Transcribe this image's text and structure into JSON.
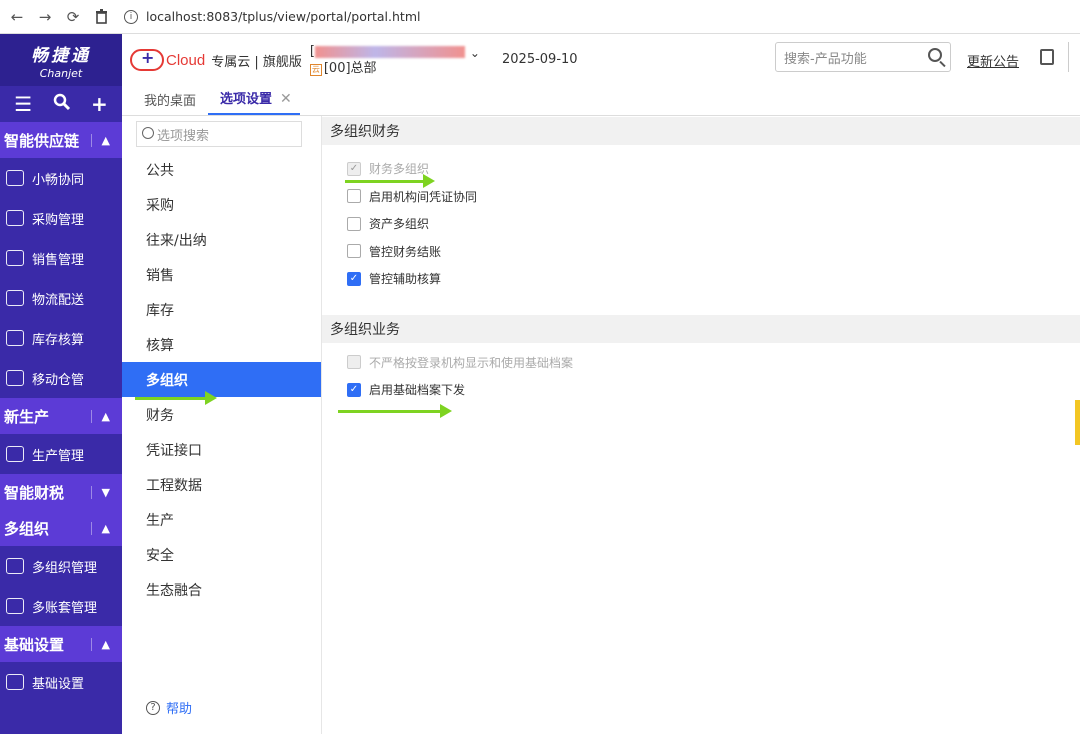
{
  "browser": {
    "back": "←",
    "forward": "→",
    "reload": "⟳",
    "info": "i",
    "url": "localhost:8083/tplus/view/portal/portal.html"
  },
  "leftnav": {
    "logo_cn": "畅捷通",
    "logo_en": "Chanjet",
    "sections": [
      {
        "label": "智能供应链",
        "items": [
          "小畅协同",
          "采购管理",
          "销售管理",
          "物流配送",
          "库存核算",
          "移动仓管"
        ]
      },
      {
        "label": "新生产",
        "items": [
          "生产管理"
        ]
      },
      {
        "label": "智能财税",
        "items": []
      },
      {
        "label": "多组织",
        "items": [
          "多组织管理",
          "多账套管理"
        ]
      },
      {
        "label": "基础设置",
        "items": [
          "基础设置"
        ]
      }
    ]
  },
  "header": {
    "brand": "Cloud",
    "edition": "专属云 | 旗舰版",
    "bracket": "[",
    "org_tag": "云",
    "org": "[00]总部",
    "date": "2025-09-10",
    "search_placeholder": "搜索-产品功能",
    "notice": "更新公告"
  },
  "tabs": [
    {
      "label": "我的桌面",
      "active": false
    },
    {
      "label": "选项设置",
      "active": true,
      "close": "✕"
    }
  ],
  "options": {
    "search_placeholder": "选项搜索",
    "items": [
      "公共",
      "采购",
      "往来/出纳",
      "销售",
      "库存",
      "核算",
      "多组织",
      "财务",
      "凭证接口",
      "工程数据",
      "生产",
      "安全",
      "生态融合"
    ],
    "active_index": 6,
    "help": "帮助",
    "help_icon": "?"
  },
  "content": {
    "groups": [
      {
        "title": "多组织财务",
        "items": [
          {
            "label": "财务多组织",
            "checked": true,
            "disabled": true
          },
          {
            "label": "启用机构间凭证协同",
            "checked": false,
            "disabled": false
          },
          {
            "label": "资产多组织",
            "checked": false,
            "disabled": false
          },
          {
            "label": "管控财务结账",
            "checked": false,
            "disabled": false
          },
          {
            "label": "管控辅助核算",
            "checked": true,
            "disabled": false
          }
        ]
      },
      {
        "title": "多组织业务",
        "items": [
          {
            "label": "不严格按登录机构显示和使用基础档案",
            "checked": false,
            "disabled": true
          },
          {
            "label": "启用基础档案下发",
            "checked": true,
            "disabled": false
          }
        ]
      }
    ]
  },
  "colors": {
    "nav_bg": "#3a2aa8",
    "section_bg": "#5c3bd6",
    "accent": "#2f6ef5",
    "annotation_arrow": "#7ed321"
  }
}
